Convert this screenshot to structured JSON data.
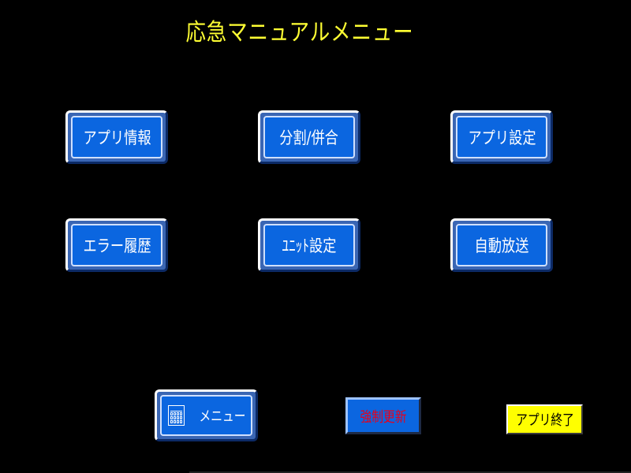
{
  "title": "応急マニュアルメニュー",
  "buttons": {
    "app_info": "アプリ情報",
    "split_merge": "分割/併合",
    "app_settings": "アプリ設定",
    "error_history": "エラー履歴",
    "unit_settings": "ﾕﾆｯﾄ設定",
    "auto_broadcast": "自動放送",
    "menu": "メニュー",
    "force_update": "強制更新",
    "app_exit": "アプリ終了"
  },
  "icons": {
    "menu": "grid-calendar-icon"
  },
  "colors": {
    "background": "#000000",
    "title": "#FFFF33",
    "button_face": "#0B66E0",
    "force_update_text": "#E8001A",
    "exit_button": "#FFFF00"
  }
}
